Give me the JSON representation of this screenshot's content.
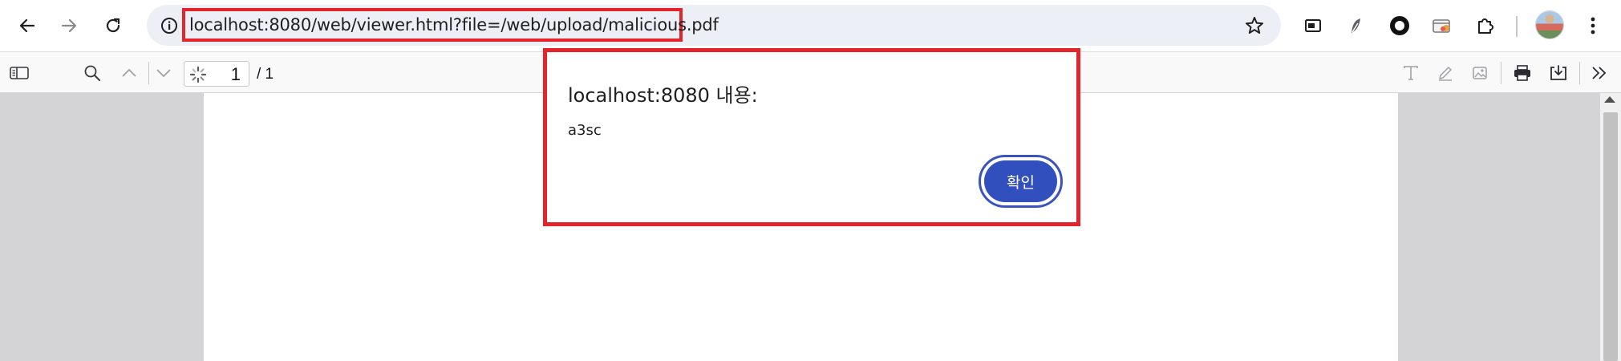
{
  "browser": {
    "url": "localhost:8080/web/viewer.html?file=/web/upload/malicious.pdf",
    "icons": {
      "back": "arrow-left-icon",
      "forward": "arrow-right-icon",
      "reload": "reload-icon",
      "site_info": "info-icon",
      "bookmark": "star-icon",
      "extensions": [
        "picture-in-picture-icon",
        "feather-extension-icon",
        "circle-extension-icon",
        "tab-groups-icon",
        "puzzle-icon"
      ],
      "menu": "kebab-menu-icon"
    }
  },
  "pdf_toolbar": {
    "page_number": "1",
    "page_total": "/ 1",
    "icons": [
      "sidebar-toggle-icon",
      "search-icon",
      "chevron-up-icon",
      "chevron-down-icon",
      "text-tool-icon",
      "draw-tool-icon",
      "image-tool-icon",
      "print-icon",
      "download-icon",
      "double-chevron-right-icon"
    ]
  },
  "dialog": {
    "title": "localhost:8080 내용:",
    "message": "a3sc",
    "confirm_label": "확인"
  },
  "colors": {
    "highlight": "#e3252b",
    "button": "#3150bd",
    "omnibox": "#edeff7",
    "viewer_bg": "#d4d4d7"
  }
}
